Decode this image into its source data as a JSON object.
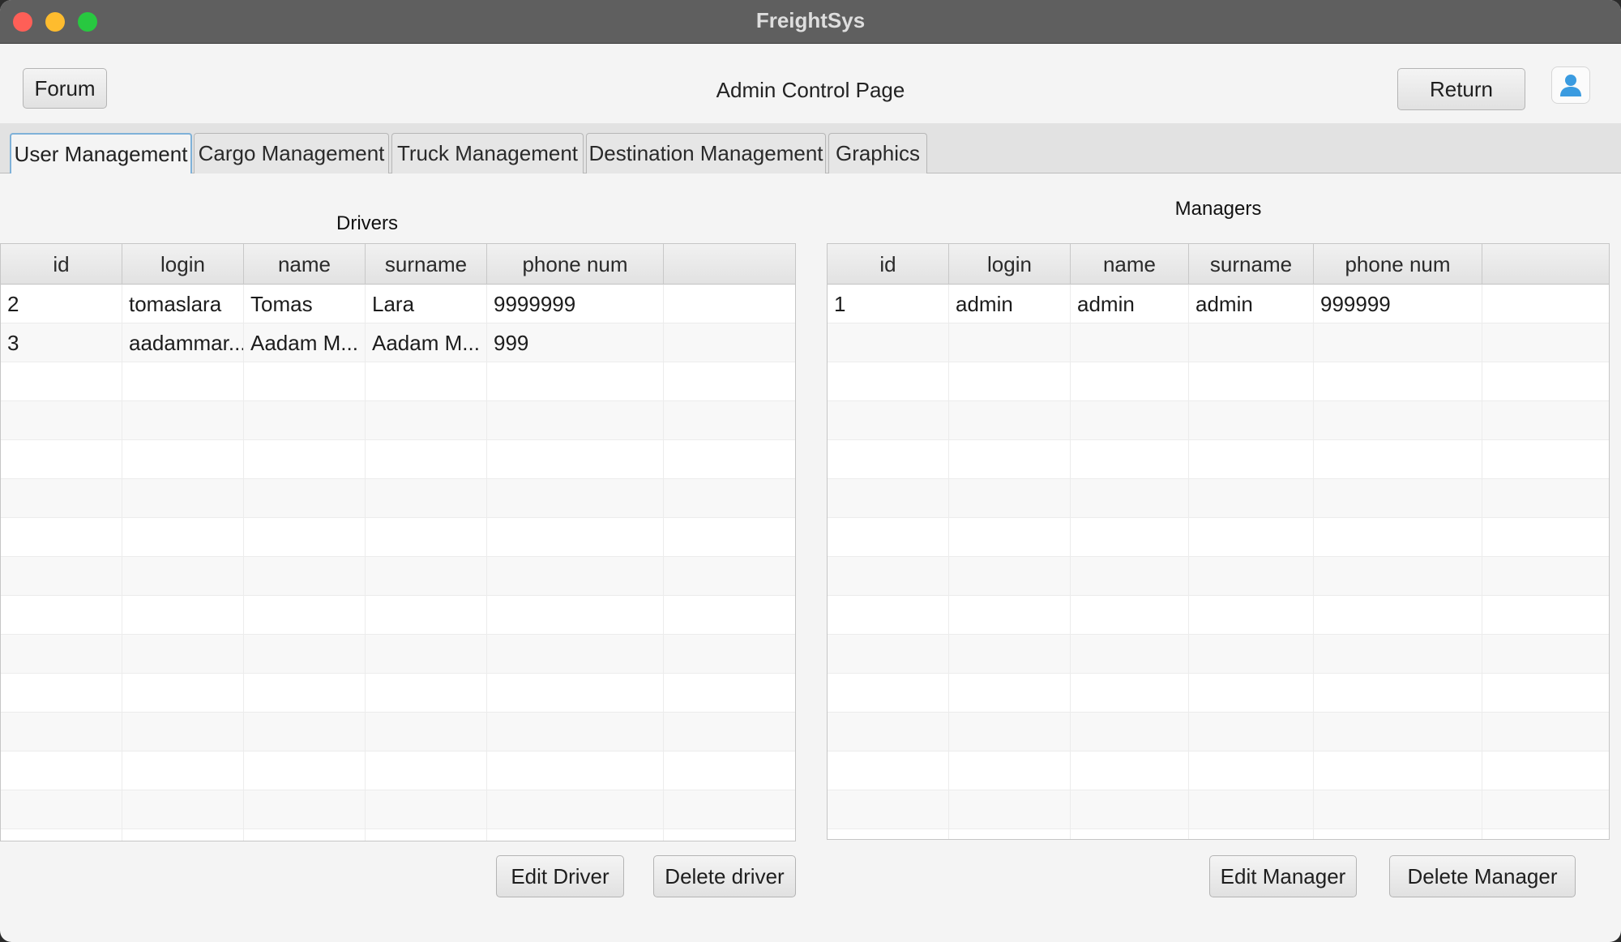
{
  "window": {
    "title": "FreightSys"
  },
  "header": {
    "forum_label": "Forum",
    "page_title": "Admin Control Page",
    "return_label": "Return",
    "avatar_icon": "user-icon",
    "accent": "#3a9be0"
  },
  "tabs": [
    {
      "label": "User Management",
      "active": true
    },
    {
      "label": "Cargo Management",
      "active": false
    },
    {
      "label": "Truck Management",
      "active": false
    },
    {
      "label": "Destination Management",
      "active": false
    },
    {
      "label": "Graphics",
      "active": false
    }
  ],
  "drivers": {
    "title": "Drivers",
    "columns": [
      "id",
      "login",
      "name",
      "surname",
      "phone num"
    ],
    "rows": [
      [
        "2",
        "tomaslara",
        "Tomas",
        "Lara",
        "9999999"
      ],
      [
        "3",
        "aadammar...",
        "Aadam M...",
        "Aadam M...",
        "999"
      ]
    ],
    "edit_label": "Edit Driver",
    "delete_label": "Delete driver"
  },
  "managers": {
    "title": "Managers",
    "columns": [
      "id",
      "login",
      "name",
      "surname",
      "phone num"
    ],
    "rows": [
      [
        "1",
        "admin",
        "admin",
        "admin",
        "999999"
      ]
    ],
    "edit_label": "Edit Manager",
    "delete_label": "Delete Manager"
  }
}
